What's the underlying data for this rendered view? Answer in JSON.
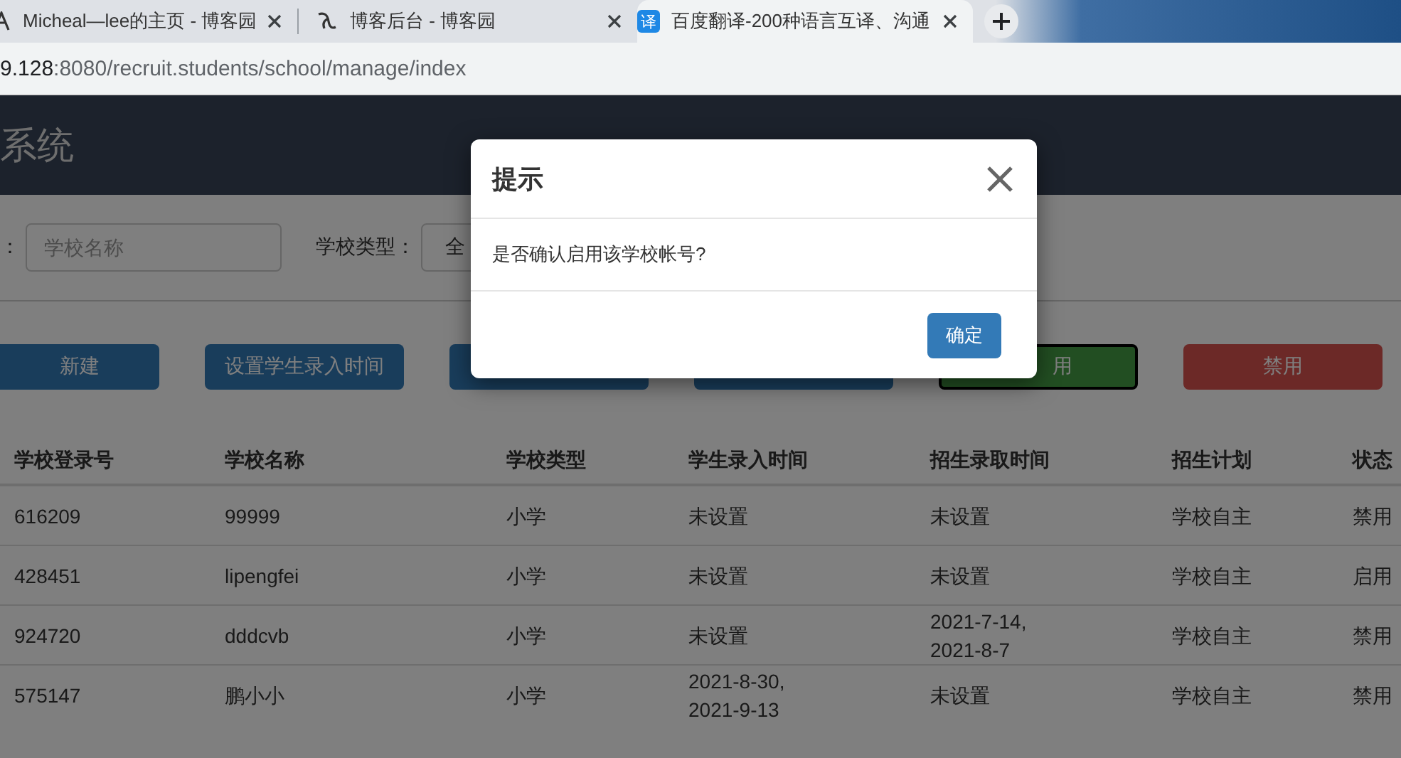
{
  "browser": {
    "tabs": [
      {
        "title": "Micheal—lee的主页 - 博客园",
        "selected": false
      },
      {
        "title": "博客后台 - 博客园",
        "selected": false
      },
      {
        "title": "百度翻译-200种语言互译、沟通",
        "selected": true,
        "icon_text": "译"
      }
    ],
    "address": {
      "host": "9.128",
      "path": ":8080/recruit.students/school/manage/index"
    }
  },
  "page": {
    "header_title": "系统",
    "filters": [
      {
        "label": "：",
        "kind": "input",
        "placeholder": "学校名称"
      },
      {
        "label": "学校类型：",
        "kind": "select",
        "value": "全"
      }
    ],
    "buttons": [
      {
        "label": "新建",
        "kind": "primary"
      },
      {
        "label": "设置学生录入时间",
        "kind": "primary"
      },
      {
        "kind": "primary"
      },
      {
        "kind": "primary"
      },
      {
        "label": "用",
        "kind": "success"
      },
      {
        "label": "禁用",
        "kind": "danger"
      }
    ],
    "table": {
      "columns": [
        "学校登录号",
        "学校名称",
        "学校类型",
        "学生录入时间",
        "招生录取时间",
        "招生计划",
        "状态"
      ],
      "rows": [
        [
          "616209",
          "99999",
          "小学",
          "未设置",
          "未设置",
          "学校自主",
          "禁用"
        ],
        [
          "428451",
          "lipengfei",
          "小学",
          "未设置",
          "未设置",
          "学校自主",
          "启用"
        ],
        [
          "924720",
          "dddcvb",
          "小学",
          "未设置",
          "2021-7-14,\n2021-8-7",
          "学校自主",
          "禁用"
        ],
        [
          "575147",
          "鹏小小",
          "小学",
          "2021-8-30,\n2021-9-13",
          "未设置",
          "学校自主",
          "禁用"
        ]
      ]
    }
  },
  "modal": {
    "title": "提示",
    "message": "是否确认启用该学校帐号?",
    "confirm": "确定"
  }
}
